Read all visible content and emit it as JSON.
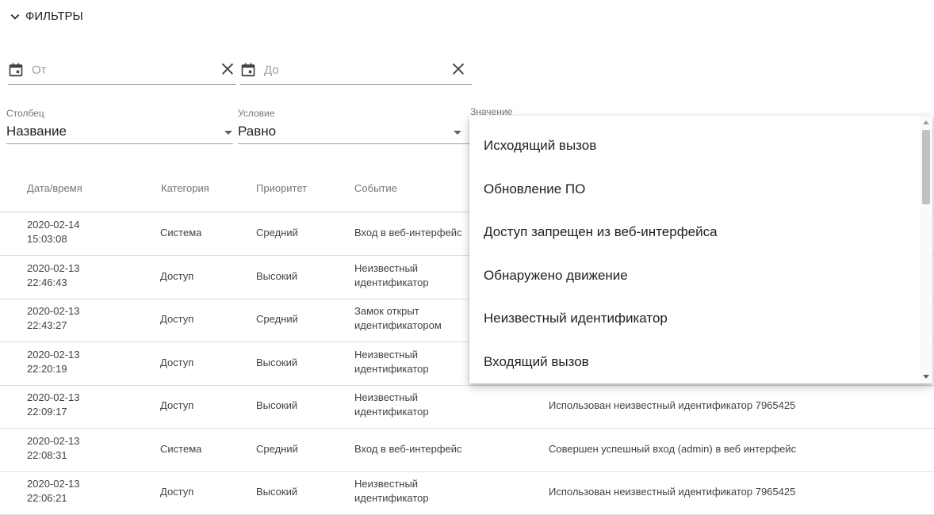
{
  "filters": {
    "toggle_label": "ФИЛЬТРЫ",
    "date_from_placeholder": "От",
    "date_to_placeholder": "До",
    "column_label": "Столбец",
    "column_value": "Название",
    "condition_label": "Условие",
    "condition_value": "Равно",
    "value_label": "Значение"
  },
  "table": {
    "headers": [
      "Дата/время",
      "Категория",
      "Приоритет",
      "Событие"
    ],
    "rows": [
      {
        "date": "2020-02-14",
        "time": "15:03:08",
        "category": "Система",
        "priority": "Средний",
        "event1": "Вход в веб-интерфейс",
        "event2": "",
        "description": ""
      },
      {
        "date": "2020-02-13",
        "time": "22:46:43",
        "category": "Доступ",
        "priority": "Высокий",
        "event1": "Неизвестный",
        "event2": "идентификатор",
        "description": ""
      },
      {
        "date": "2020-02-13",
        "time": "22:43:27",
        "category": "Доступ",
        "priority": "Средний",
        "event1": "Замок открыт",
        "event2": "идентификатором",
        "description": ""
      },
      {
        "date": "2020-02-13",
        "time": "22:20:19",
        "category": "Доступ",
        "priority": "Высокий",
        "event1": "Неизвестный",
        "event2": "идентификатор",
        "description": ""
      },
      {
        "date": "2020-02-13",
        "time": "22:09:17",
        "category": "Доступ",
        "priority": "Высокий",
        "event1": "Неизвестный",
        "event2": "идентификатор",
        "description": "Использован неизвестный идентификатор 7965425"
      },
      {
        "date": "2020-02-13",
        "time": "22:08:31",
        "category": "Система",
        "priority": "Средний",
        "event1": "Вход в веб-интерфейс",
        "event2": "",
        "description": "Совершен успешный вход (admin) в веб интерфейс"
      },
      {
        "date": "2020-02-13",
        "time": "22:06:21",
        "category": "Доступ",
        "priority": "Высокий",
        "event1": "Неизвестный",
        "event2": "идентификатор",
        "description": "Использован неизвестный идентификатор 7965425"
      }
    ]
  },
  "dropdown": {
    "options": [
      "Исходящий вызов",
      "Обновление ПО",
      "Доступ запрещен из веб-интерфейса",
      "Обнаружено движение",
      "Неизвестный идентификатор",
      "Входящий вызов"
    ]
  },
  "icons": {
    "filters_toggle": "chevron-down-icon",
    "date": "calendar-icon",
    "clear": "close-icon",
    "select": "caret-down-icon"
  },
  "colors": {
    "text": "#212121",
    "muted": "#757575",
    "divider": "#e0e0e0",
    "underline": "#9e9e9e"
  }
}
